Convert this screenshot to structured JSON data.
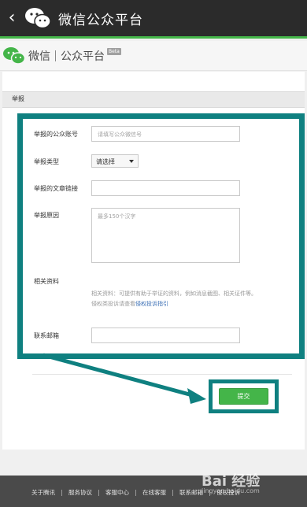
{
  "topbar": {
    "back_icon": "chevron-left-icon",
    "title": "微信公众平台"
  },
  "brand": {
    "name": "微信",
    "subtitle": "公众平台",
    "beta": "Beta"
  },
  "section": {
    "title": "举报"
  },
  "form": {
    "account": {
      "label": "举报的公众账号",
      "placeholder": "请填写公众微信号"
    },
    "type": {
      "label": "举报类型",
      "selected": "请选择"
    },
    "link": {
      "label": "举报的文章链接",
      "value": ""
    },
    "reason": {
      "label": "举报原因",
      "placeholder": "最多150个汉字"
    },
    "materials": {
      "label": "相关资料",
      "note": "相关资料：可提供有助于举证的资料，例如消息截图、相关证件等。",
      "note2": "侵权类投诉请查看",
      "guide_link": "侵权投诉指引"
    },
    "email": {
      "label": "联系邮箱",
      "value": ""
    },
    "submit_label": "提交"
  },
  "footer": {
    "links": [
      "关于腾讯",
      "服务协议",
      "客服中心",
      "在线客服",
      "联系邮箱",
      "侵权投诉"
    ]
  },
  "watermark": {
    "text": "Bai 经验",
    "sub": "jingyan.baidu.com"
  },
  "colors": {
    "accent": "#44b549",
    "highlight": "#0f8080",
    "topbar": "#2b2b2b"
  }
}
